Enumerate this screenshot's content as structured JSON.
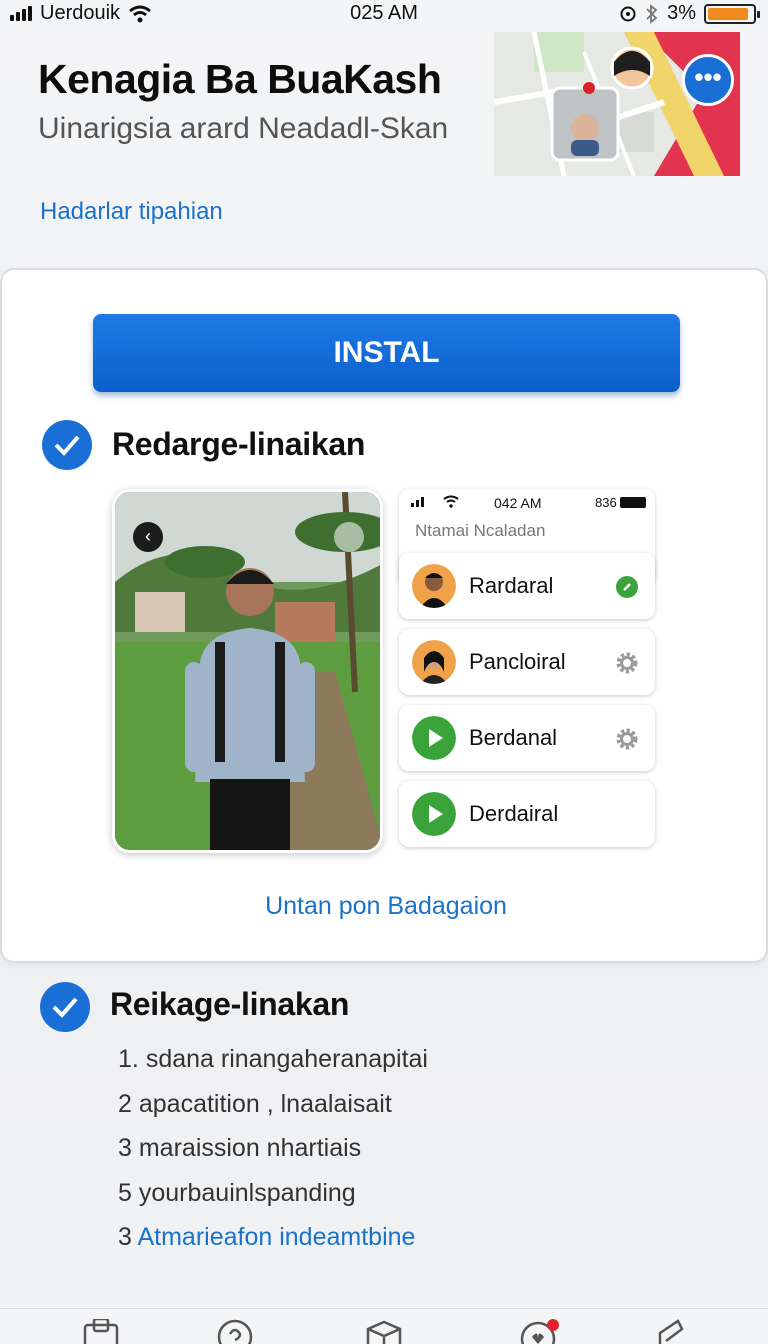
{
  "status_bar": {
    "carrier": "Uerdouik",
    "time": "025 AM",
    "battery_percent": "3%",
    "battery_level": 0.9,
    "accent_battery": "#f08a1c"
  },
  "header": {
    "title": "Kenagia Ba BuaKash",
    "subtitle": "Uinarigsia arard Neadadl-Skan",
    "link": "Hadarlar tipahian"
  },
  "map": {
    "icon": "more-horizontal-icon"
  },
  "card": {
    "install_label": "INSTAL",
    "section1_title": "Redarge-linaikan",
    "preview": {
      "mini_time": "042 AM",
      "mini_battery": "836",
      "list_header": "Ntamai Ncaladan",
      "items": [
        {
          "label": "Rardaral",
          "avatar": "person-avatar",
          "right_icon": "green-dot-icon"
        },
        {
          "label": "Pancloiral",
          "avatar": "person-avatar",
          "right_icon": "gear-icon"
        },
        {
          "label": "Berdanal",
          "avatar": "play-icon",
          "right_icon": "gear-icon"
        },
        {
          "label": "Derdairal",
          "avatar": "play-icon",
          "right_icon": ""
        }
      ]
    },
    "link": "Untan pon Badagaion"
  },
  "section2": {
    "title": "Reikage-linakan",
    "steps": [
      {
        "num": "1.",
        "text": "sdana rinangaheranapitai"
      },
      {
        "num": "2",
        "text": "apacatition , lnaalaisait"
      },
      {
        "num": "3",
        "text": "maraission nhartiais"
      },
      {
        "num": "5",
        "text": "yourbauinlspanding"
      },
      {
        "num": "3",
        "text": "Atmarieafon indeamtbine"
      }
    ]
  },
  "colors": {
    "primary": "#1a6fd6",
    "link": "#1a73c9",
    "green": "#3aa43a"
  }
}
